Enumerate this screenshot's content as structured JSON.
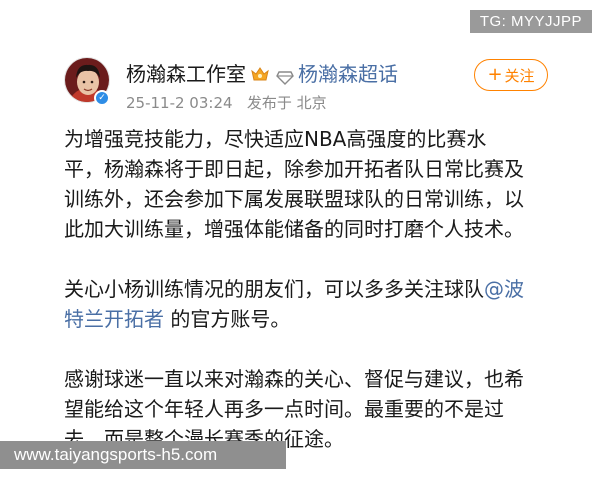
{
  "watermark_tg": "TG: MYYJJPP",
  "author": {
    "name": "杨瀚森工作室",
    "topic": "杨瀚森超话",
    "timestamp": "25-11-2 03:24",
    "source": "发布于 北京"
  },
  "follow_button": {
    "plus": "+",
    "label": "关注"
  },
  "post": {
    "para1": "为增强竞技能力，尽快适应NBA高强度的比赛水\n平，杨瀚森将于即日起，除参加开拓者队日常比赛及\n训练外，还会参加下属发展联盟球队的日常训练，以\n此加大训练量，增强体能储备的同时打磨个人技术。",
    "para2_before": "关心小杨训练情况的朋友们，可以多多关注球队",
    "para2_mention": "@波\n特兰开拓者",
    "para2_after": " 的官方账号。",
    "para3": "感谢球迷一直以来对瀚森的关心、督促与建议，也希\n望能给这个年轻人再多一点时间。最重要的不是过\n去，而是整个漫长赛季的征途。"
  },
  "watermark_url": "www.taiyangsports-h5.com",
  "colors": {
    "link_blue": "#4a6fa5",
    "follow_orange": "#ff8200",
    "meta_gray": "#8a8a8a",
    "verified_blue": "#2e8de6"
  },
  "icons": [
    "avatar",
    "verified-icon",
    "vip-badge-icon",
    "diamond-icon",
    "plus-icon"
  ]
}
